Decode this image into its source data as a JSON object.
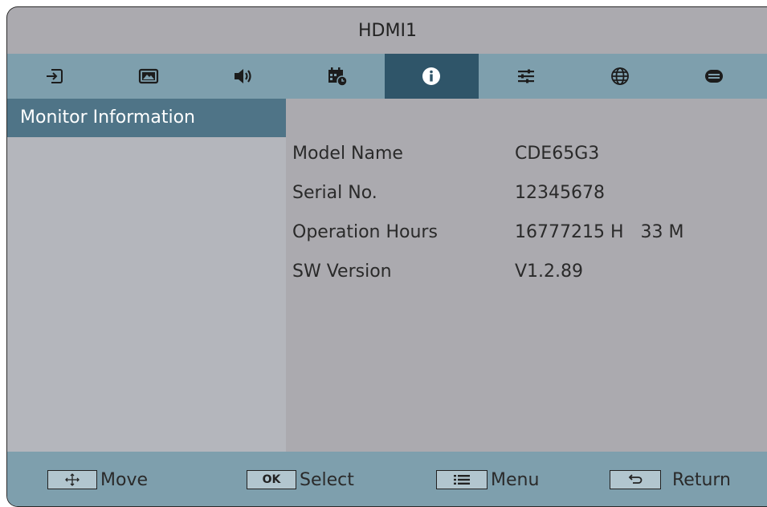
{
  "title": "HDMI1",
  "tabs": [
    {
      "icon": "input-source-icon",
      "active": false
    },
    {
      "icon": "picture-icon",
      "active": false
    },
    {
      "icon": "speaker-icon",
      "active": false
    },
    {
      "icon": "schedule-icon",
      "active": false
    },
    {
      "icon": "info-icon",
      "active": true
    },
    {
      "icon": "settings-sliders-icon",
      "active": false
    },
    {
      "icon": "globe-icon",
      "active": false
    },
    {
      "icon": "display-port-icon",
      "active": false
    }
  ],
  "sidebar": {
    "items": [
      {
        "label": "Monitor Information",
        "selected": true
      }
    ]
  },
  "info": {
    "rows": [
      {
        "label": "Model Name",
        "value": "CDE65G3"
      },
      {
        "label": "Serial No.",
        "value": "12345678"
      },
      {
        "label": "Operation Hours",
        "value": "16777215 H   33 M"
      },
      {
        "label": "SW Version",
        "value": "V1.2.89"
      }
    ]
  },
  "footer": {
    "move": {
      "label": "Move",
      "key_icon": "four-way-arrow-icon"
    },
    "select": {
      "label": "Select",
      "key_text": "OK"
    },
    "menu": {
      "label": "Menu",
      "key_icon": "menu-lines-icon"
    },
    "return": {
      "label": "Return",
      "key_icon": "return-arrow-icon"
    }
  },
  "colors": {
    "background": "#abaaaf",
    "tab_bar": "#7e9fad",
    "tab_active": "#2f5569",
    "sidebar_selected": "#4f7487",
    "footer": "#7e9fad"
  }
}
